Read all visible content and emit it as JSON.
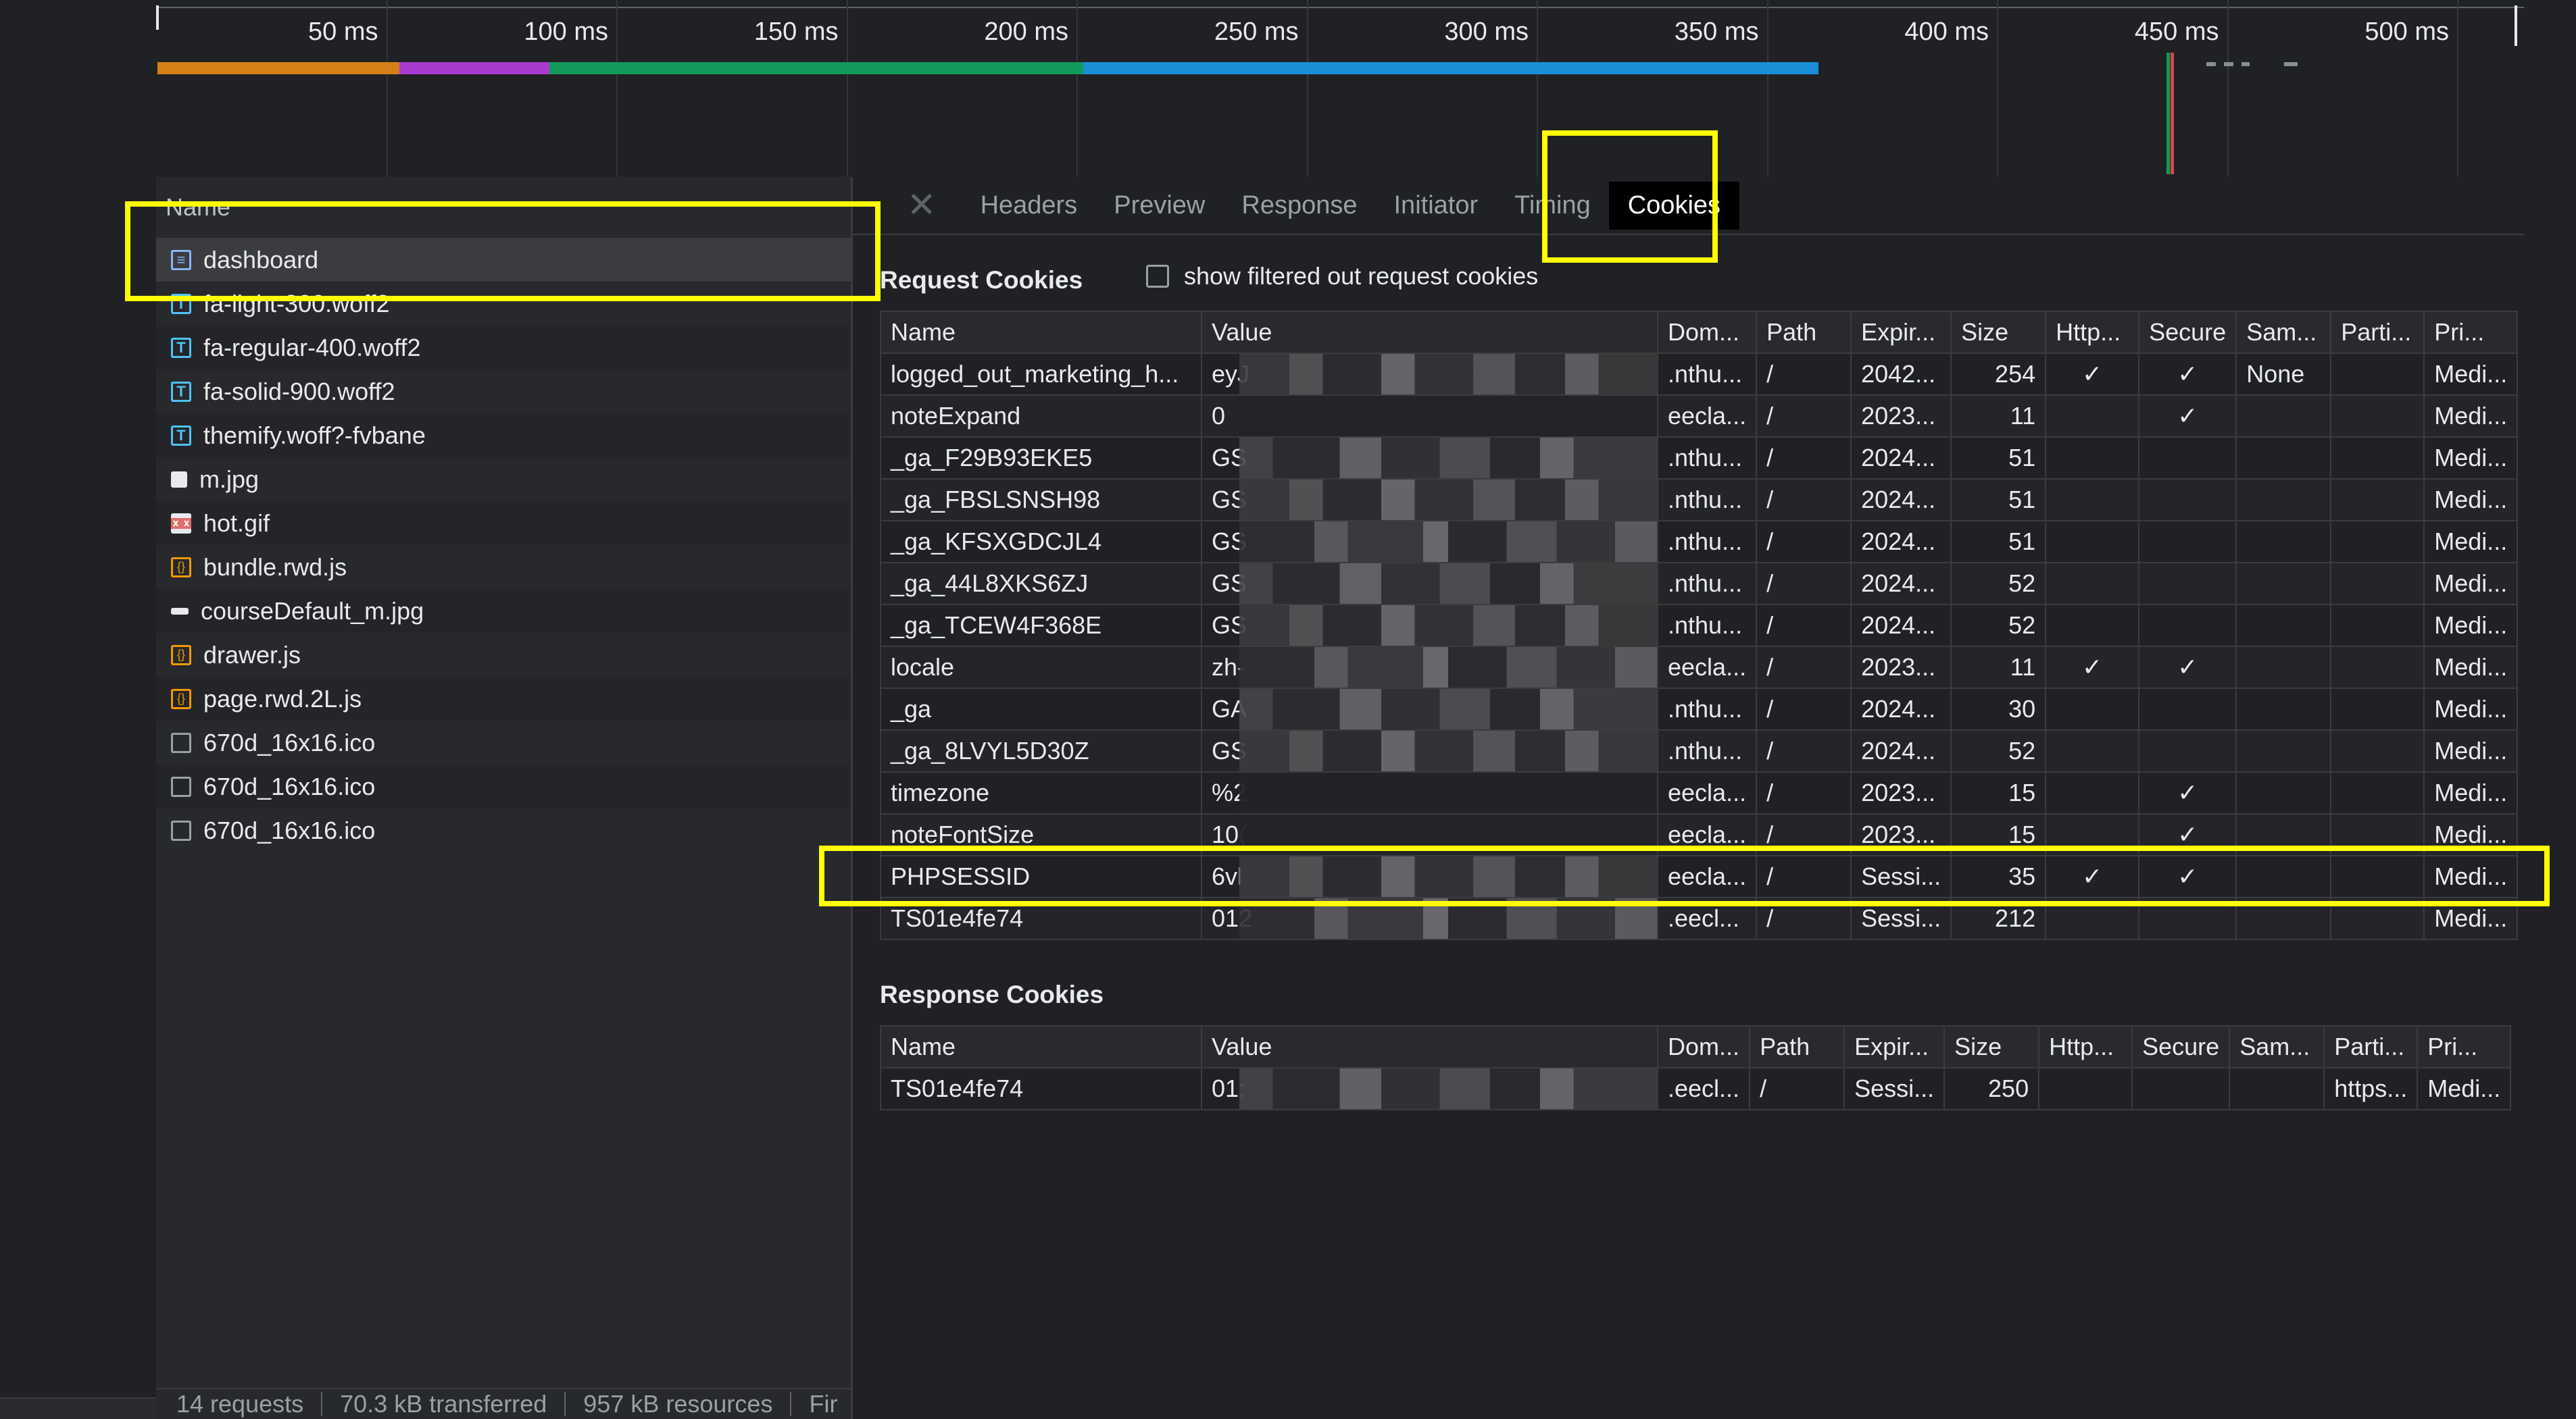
{
  "timeline": {
    "ticks": [
      "50 ms",
      "100 ms",
      "150 ms",
      "200 ms",
      "250 ms",
      "300 ms",
      "350 ms",
      "400 ms",
      "450 ms",
      "500 ms"
    ],
    "colors": {
      "orange": "#d67f17",
      "purple": "#a93bd1",
      "green": "#139a5b",
      "blue": "#1a8fd8"
    }
  },
  "requests": {
    "header": "Name",
    "items": [
      {
        "name": "dashboard",
        "icon": "document-icon"
      },
      {
        "name": "fa-light-300.woff2",
        "icon": "font-icon"
      },
      {
        "name": "fa-regular-400.woff2",
        "icon": "font-icon"
      },
      {
        "name": "fa-solid-900.woff2",
        "icon": "font-icon"
      },
      {
        "name": "themify.woff?-fvbane",
        "icon": "font-icon"
      },
      {
        "name": "m.jpg",
        "icon": "image-icon"
      },
      {
        "name": "hot.gif",
        "icon": "gif-icon"
      },
      {
        "name": "bundle.rwd.js",
        "icon": "script-icon"
      },
      {
        "name": "courseDefault_m.jpg",
        "icon": "image-icon"
      },
      {
        "name": "drawer.js",
        "icon": "script-icon"
      },
      {
        "name": "page.rwd.2L.js",
        "icon": "script-icon"
      },
      {
        "name": "670d_16x16.ico",
        "icon": "ico-icon"
      },
      {
        "name": "670d_16x16.ico",
        "icon": "ico-icon"
      },
      {
        "name": "670d_16x16.ico",
        "icon": "ico-icon"
      }
    ]
  },
  "status": {
    "requests": "14 requests",
    "transferred": "70.3 kB transferred",
    "resources": "957 kB resources",
    "finish": "Fir"
  },
  "tabs": {
    "close": "✕",
    "items": [
      "Headers",
      "Preview",
      "Response",
      "Initiator",
      "Timing",
      "Cookies"
    ],
    "active": "Cookies"
  },
  "request_cookies": {
    "title": "Request Cookies",
    "filter_label": "show filtered out request cookies",
    "columns": [
      "Name",
      "Value",
      "Dom...",
      "Path",
      "Expir...",
      "Size",
      "Http...",
      "Secure",
      "Sam...",
      "Parti...",
      "Pri..."
    ],
    "rows": [
      [
        "logged_out_marketing_h...",
        "eyJ",
        ".nthu...",
        "/",
        "2042...",
        "254",
        "✓",
        "✓",
        "None",
        "",
        "Medi..."
      ],
      [
        "noteExpand",
        "0",
        "eecla...",
        "/",
        "2023...",
        "11",
        "",
        "✓",
        "",
        "",
        "Medi..."
      ],
      [
        "_ga_F29B93EKE5",
        "GS",
        ".nthu...",
        "/",
        "2024...",
        "51",
        "",
        "",
        "",
        "",
        "Medi..."
      ],
      [
        "_ga_FBSLSNSH98",
        "GS",
        ".nthu...",
        "/",
        "2024...",
        "51",
        "",
        "",
        "",
        "",
        "Medi..."
      ],
      [
        "_ga_KFSXGDCJL4",
        "GS",
        ".nthu...",
        "/",
        "2024...",
        "51",
        "",
        "",
        "",
        "",
        "Medi..."
      ],
      [
        "_ga_44L8XKS6ZJ",
        "GS",
        ".nthu...",
        "/",
        "2024...",
        "52",
        "",
        "",
        "",
        "",
        "Medi..."
      ],
      [
        "_ga_TCEW4F368E",
        "GS",
        ".nthu...",
        "/",
        "2024...",
        "52",
        "",
        "",
        "",
        "",
        "Medi..."
      ],
      [
        "locale",
        "zh-",
        "eecla...",
        "/",
        "2023...",
        "11",
        "✓",
        "✓",
        "",
        "",
        "Medi..."
      ],
      [
        "_ga",
        "GA",
        ".nthu...",
        "/",
        "2024...",
        "30",
        "",
        "",
        "",
        "",
        "Medi..."
      ],
      [
        "_ga_8LVYL5D30Z",
        "GS",
        ".nthu...",
        "/",
        "2024...",
        "52",
        "",
        "",
        "",
        "",
        "Medi..."
      ],
      [
        "timezone",
        "%2",
        "eecla...",
        "/",
        "2023...",
        "15",
        "",
        "✓",
        "",
        "",
        "Medi..."
      ],
      [
        "noteFontSize",
        "10(",
        "eecla...",
        "/",
        "2023...",
        "15",
        "",
        "✓",
        "",
        "",
        "Medi..."
      ],
      [
        "PHPSESSID",
        "6vl",
        "eecla...",
        "/",
        "Sessi...",
        "35",
        "✓",
        "✓",
        "",
        "",
        "Medi..."
      ],
      [
        "TS01e4fe74",
        "012",
        ".eecl...",
        "/",
        "Sessi...",
        "212",
        "",
        "",
        "",
        "",
        "Medi..."
      ]
    ]
  },
  "response_cookies": {
    "title": "Response Cookies",
    "columns": [
      "Name",
      "Value",
      "Dom...",
      "Path",
      "Expir...",
      "Size",
      "Http...",
      "Secure",
      "Sam...",
      "Parti...",
      "Pri..."
    ],
    "rows": [
      [
        "TS01e4fe74",
        "01:",
        ".eecl...",
        "/",
        "Sessi...",
        "250",
        "",
        "",
        "",
        "https...",
        "Medi..."
      ]
    ]
  },
  "highlight_color": "#ffff00"
}
